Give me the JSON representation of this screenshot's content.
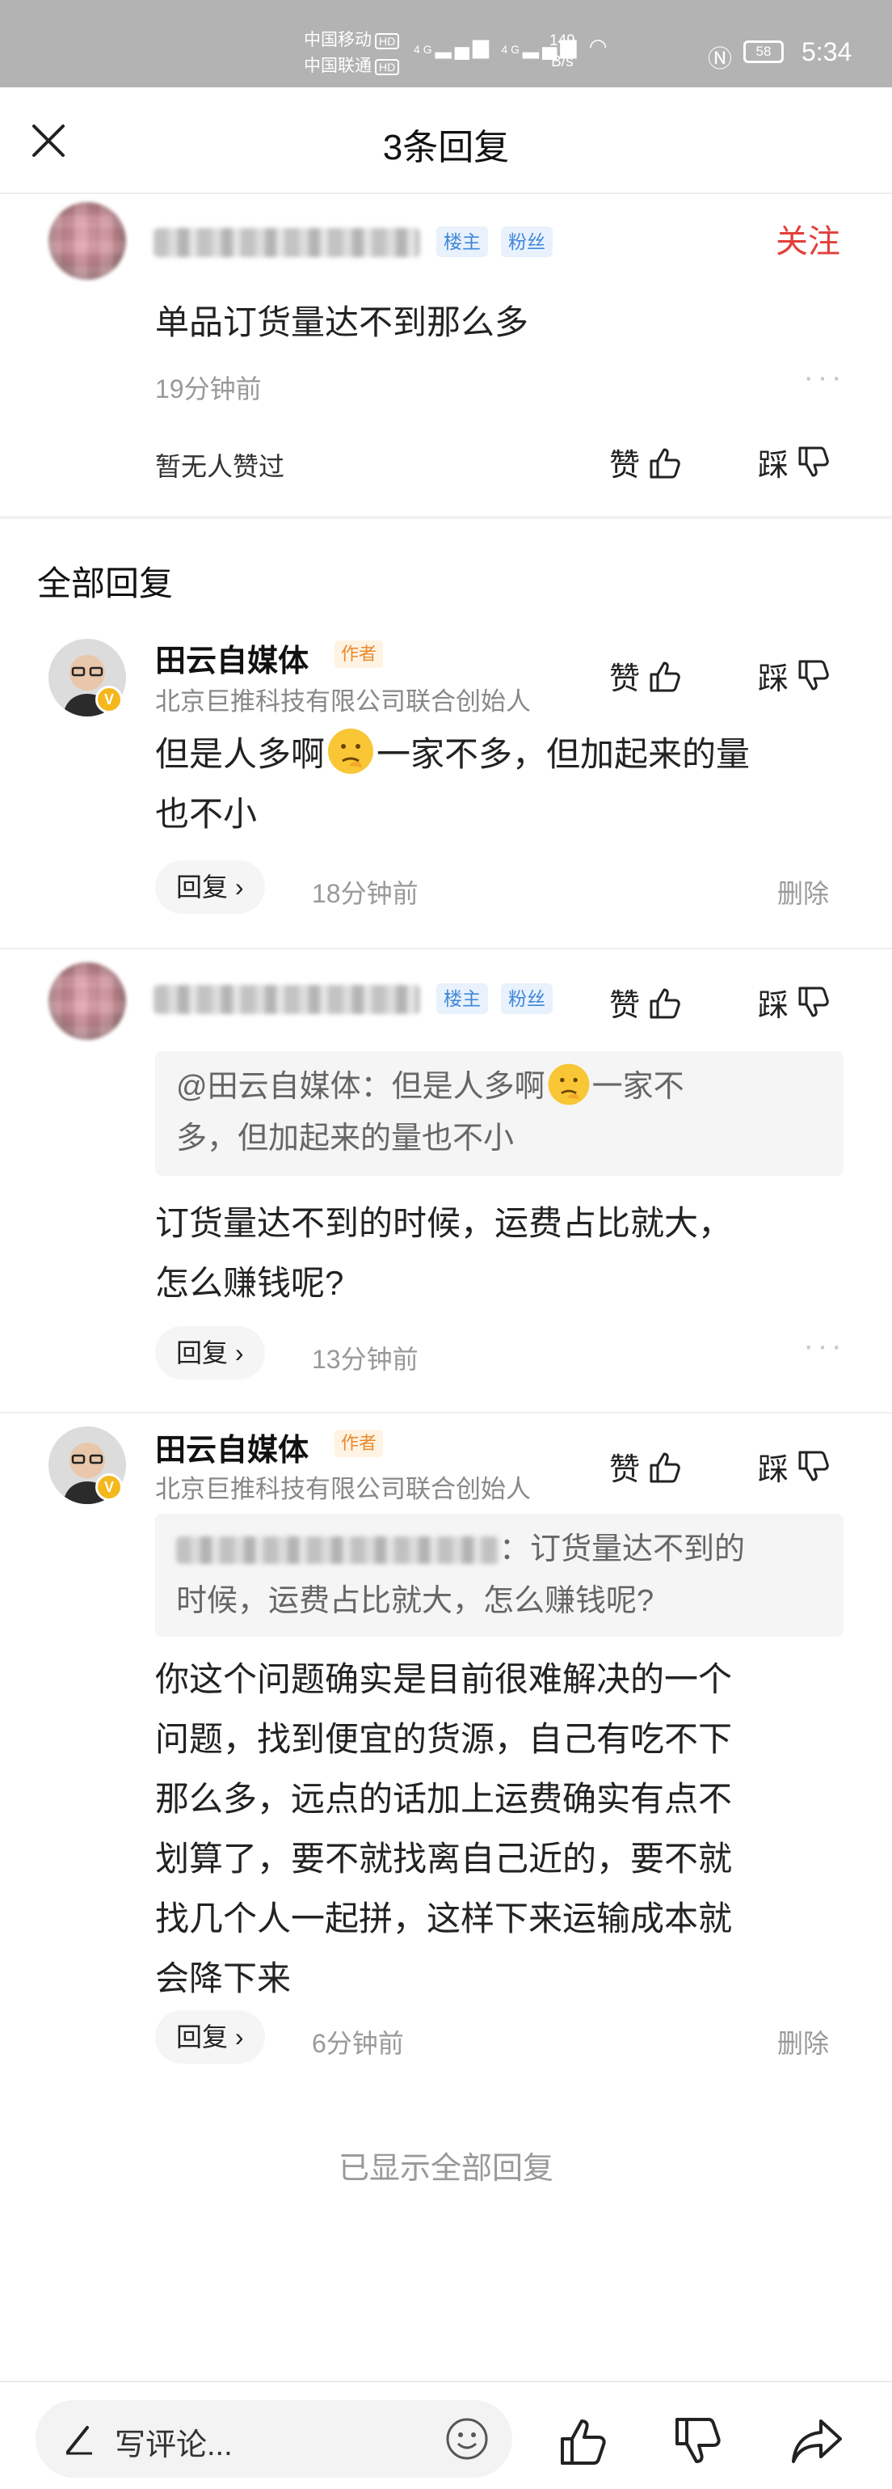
{
  "status_bar": {
    "carrier1": "中国移动",
    "carrier2": "中国联通",
    "hd": "HD",
    "net": "4G",
    "speed_value": "149",
    "speed_unit": "B/s",
    "battery": "58",
    "time": "5:34"
  },
  "header": {
    "title": "3条回复"
  },
  "main_comment": {
    "tags": [
      "楼主",
      "粉丝"
    ],
    "follow": "关注",
    "text": "单品订货量达不到那么多",
    "time": "19分钟前",
    "no_likes": "暂无人赞过",
    "like": "赞",
    "dislike": "踩"
  },
  "section_title": "全部回复",
  "replies": [
    {
      "username": "田云自媒体",
      "badge": "作者",
      "subtitle": "北京巨推科技有限公司联合创始人",
      "text_a": "但是人多啊",
      "text_b": "一家不多，但加起来的量",
      "text_c": "也不小",
      "reply": "回复",
      "time": "18分钟前",
      "delete": "删除",
      "like": "赞",
      "dislike": "踩"
    },
    {
      "tags": [
        "楼主",
        "粉丝"
      ],
      "quote_a": "@田云自媒体：但是人多啊",
      "quote_b": "一家不",
      "quote_c": "多，但加起来的量也不小",
      "text_line1": "订货量达不到的时候，运费占比就大，",
      "text_line2": "怎么赚钱呢?",
      "reply": "回复",
      "time": "13分钟前",
      "like": "赞",
      "dislike": "踩"
    },
    {
      "username": "田云自媒体",
      "badge": "作者",
      "subtitle": "北京巨推科技有限公司联合创始人",
      "quote_a": "：订货量达不到的",
      "quote_b": "时候，运费占比就大，怎么赚钱呢?",
      "lines": [
        "你这个问题确实是目前很难解决的一个",
        "问题，找到便宜的货源，自己有吃不下",
        "那么多，远点的话加上运费确实有点不",
        "划算了，要不就找离自己近的，要不就",
        "找几个人一起拼，这样下来运输成本就",
        "会降下来"
      ],
      "reply": "回复",
      "time": "6分钟前",
      "delete": "删除",
      "like": "赞",
      "dislike": "踩"
    }
  ],
  "end_text": "已显示全部回复",
  "bottom_bar": {
    "placeholder": "写评论..."
  }
}
